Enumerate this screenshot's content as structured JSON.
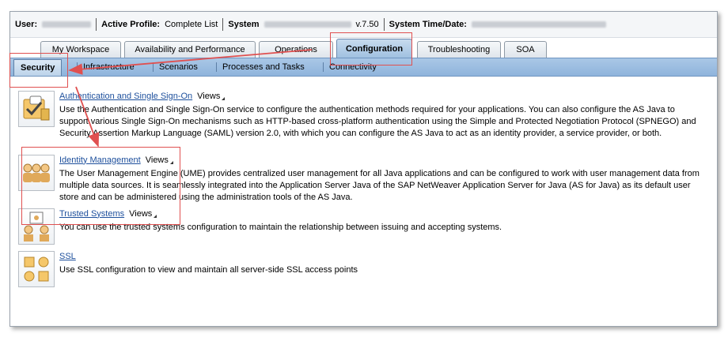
{
  "header": {
    "user_label": "User:",
    "active_profile_label": "Active Profile:",
    "active_profile_value": "Complete List",
    "system_label": "System",
    "system_version": "v.7.50",
    "system_time_label": "System Time/Date:"
  },
  "tabs": [
    {
      "label": "My Workspace"
    },
    {
      "label": "Availability and Performance"
    },
    {
      "label": "Operations"
    },
    {
      "label": "Configuration",
      "active": true
    },
    {
      "label": "Troubleshooting"
    },
    {
      "label": "SOA"
    }
  ],
  "subnav": [
    {
      "label": "Security",
      "active": true
    },
    {
      "label": "Infrastructure"
    },
    {
      "label": "Scenarios"
    },
    {
      "label": "Processes and Tasks"
    },
    {
      "label": "Connectivity"
    }
  ],
  "entries": [
    {
      "title": "Authentication and Single Sign-On",
      "views": "Views",
      "icon": "authentication-icon",
      "desc": "Use the Authentication and Single Sign-On service to configure the authentication methods required for your applications. You can also configure the AS Java to support various Single Sign-On mechanisms such as HTTP-based cross-platform authentication using the Simple and Protected Negotiation Protocol (SPNEGO) and Security Assertion Markup Language (SAML) version 2.0, with which you can configure the AS Java to act as an identity provider, a service provider, or both."
    },
    {
      "title": "Identity Management",
      "views": "Views",
      "icon": "users-icon",
      "desc": "The User Management Engine (UME) provides centralized user management for all Java applications and can be configured to work with user management data from multiple data sources. It is seamlessly integrated into the Application Server Java of the SAP NetWeaver Application Server for Java (AS for Java) as its default user store and can be administered using the administration tools of the AS Java."
    },
    {
      "title": "Trusted Systems",
      "views": "Views",
      "icon": "trusted-systems-icon",
      "desc": "You can use the trusted systems configuration to maintain the relationship between issuing and accepting systems."
    },
    {
      "title": "SSL",
      "icon": "ssl-icon",
      "desc": "Use SSL configuration to view and maintain all server-side SSL access points"
    }
  ],
  "colors": {
    "accent": "#1d4f9c",
    "annotation": "#e05050",
    "subnav": "#9dbde3"
  }
}
